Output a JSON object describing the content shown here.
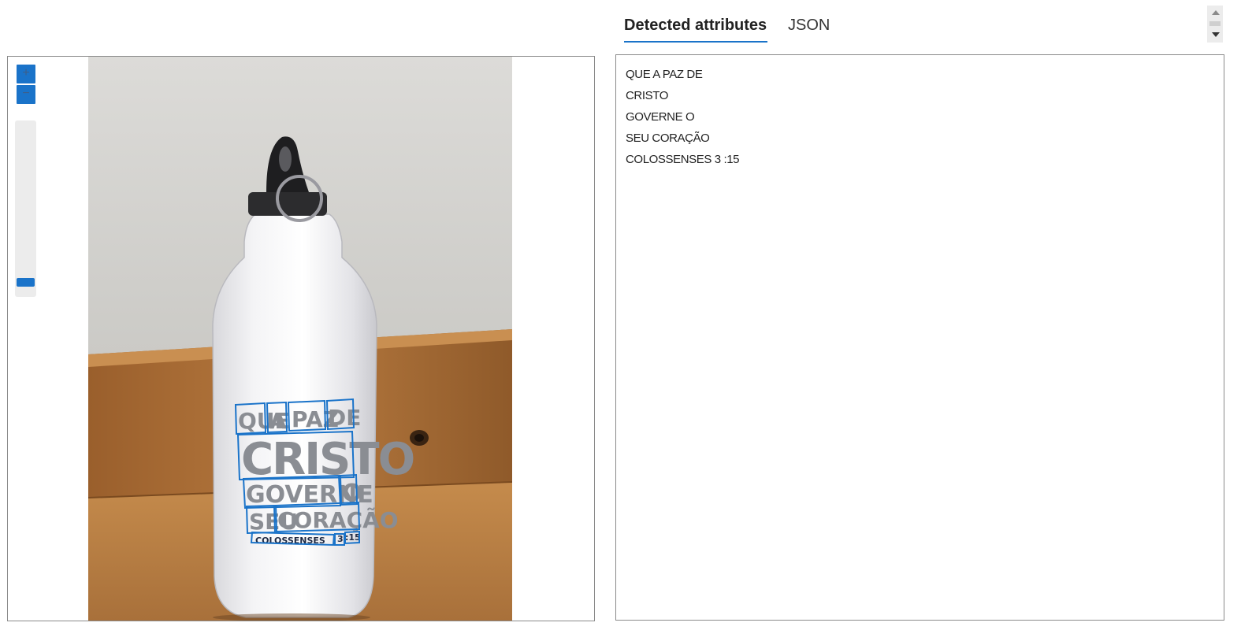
{
  "viewer": {
    "zoom_in_label": "+",
    "zoom_out_label": "−",
    "zoom_level": 0.0,
    "photo_text": {
      "line1": [
        "QUE",
        "A",
        "PAZ",
        "DE"
      ],
      "line2": "CRISTO",
      "line3": [
        "GOVERNE",
        "O"
      ],
      "line4": [
        "SEU",
        "CORAÇÃO"
      ],
      "line5": [
        "COLOSSENSES",
        "3",
        ":15"
      ]
    },
    "highlight_color": "#1a73c9"
  },
  "tabs": {
    "detected": "Detected attributes",
    "json": "JSON",
    "active": "Detected attributes"
  },
  "results": [
    "QUE A PAZ DE",
    "CRISTO",
    "GOVERNE O",
    "SEU CORAÇÃO",
    "COLOSSENSES 3 :15"
  ],
  "colors": {
    "accent": "#1a73c9",
    "border": "#8a8a8a"
  }
}
